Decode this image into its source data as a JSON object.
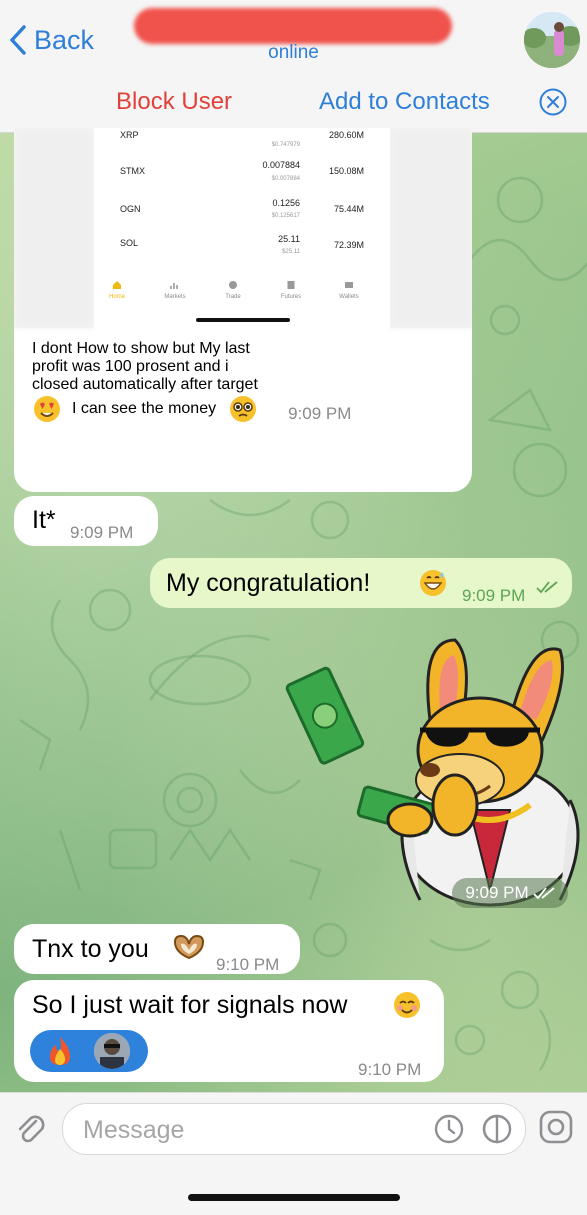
{
  "header": {
    "back_label": "Back",
    "status": "online",
    "actions": {
      "block": "Block User",
      "add": "Add to Contacts"
    }
  },
  "screenshot": {
    "rows": [
      {
        "symbol": "XRP",
        "price": "",
        "usd": "$0.747979",
        "volume": "280.60M"
      },
      {
        "symbol": "STMX",
        "price": "0.007884",
        "usd": "$0.007884",
        "volume": "150.08M"
      },
      {
        "symbol": "OGN",
        "price": "0.1256",
        "usd": "$0.125617",
        "volume": "75.44M"
      },
      {
        "symbol": "SOL",
        "price": "25.11",
        "usd": "$25.11",
        "volume": "72.39M"
      }
    ],
    "nav": [
      "Home",
      "Markets",
      "Trade",
      "Futures",
      "Wallets"
    ],
    "nav_active_color": "#f0b90b"
  },
  "messages": [
    {
      "direction": "in",
      "text_lines": [
        "I dont How to show but My last",
        "profit was 100 prosent and i",
        "closed automatically after target"
      ],
      "last_line": "I can see the money",
      "time": "9:09 PM"
    },
    {
      "direction": "in",
      "text": "It*",
      "time": "9:09 PM"
    },
    {
      "direction": "out",
      "text": "My congratulation!",
      "time": "9:09 PM"
    },
    {
      "direction": "out",
      "type": "sticker",
      "time": "9:09 PM"
    },
    {
      "direction": "in",
      "text": "Tnx to you",
      "time": "9:10 PM"
    },
    {
      "direction": "in",
      "text": "So I just wait for signals now",
      "time": "9:10 PM",
      "reactions": [
        "fire-emoji",
        "avatar"
      ]
    }
  ],
  "input": {
    "placeholder": "Message"
  },
  "colors": {
    "accent": "#2f7fd8",
    "danger": "#e0413a",
    "outgoing_bubble": "#e6f7c9",
    "incoming_bubble": "#ffffff"
  }
}
